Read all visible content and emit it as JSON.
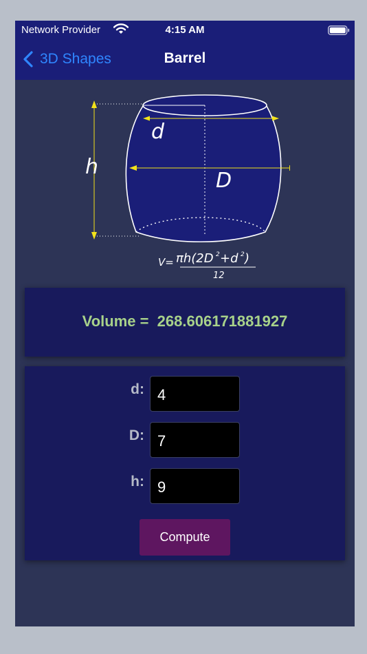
{
  "status_bar": {
    "carrier": "Network Provider",
    "time": "4:15 AM"
  },
  "nav": {
    "back_label": "3D Shapes",
    "title": "Barrel"
  },
  "diagram": {
    "label_h": "h",
    "label_d": "d",
    "label_D": "D",
    "formula_lhs": "V=",
    "formula_numer_prefix": "πh(2D",
    "formula_numer_plus": "+d",
    "formula_close": ")",
    "formula_sq": "2",
    "formula_denominator": "12"
  },
  "result": {
    "text": "Volume =  268.606171881927"
  },
  "inputs": [
    {
      "label": "d:",
      "value": "4"
    },
    {
      "label": "D:",
      "value": "7"
    },
    {
      "label": "h:",
      "value": "9"
    }
  ],
  "compute_label": "Compute",
  "colors": {
    "nav_bar": "#1a1e78",
    "background": "#2d3456",
    "card": "#181a5c",
    "accent_link": "#2f86ff",
    "result_text": "#a8d28a",
    "button": "#5e1660",
    "dimension_arrows": "#f2e21a"
  }
}
